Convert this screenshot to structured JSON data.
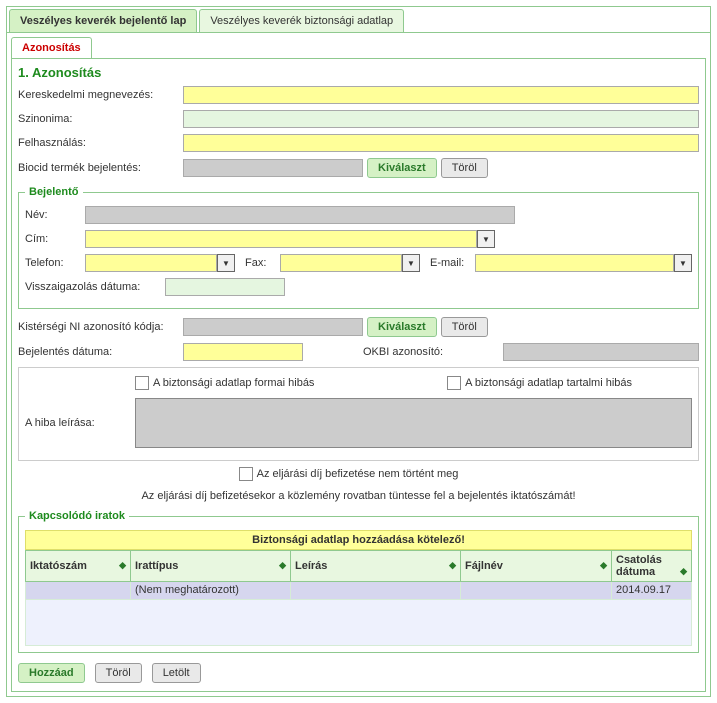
{
  "topTabs": {
    "bejelento": "Veszélyes keverék bejelentő lap",
    "biztonsagi": "Veszélyes keverék biztonsági adatlap"
  },
  "subTab": "Azonosítás",
  "section_title": "1. Azonosítás",
  "labels": {
    "keresk": "Kereskedelmi megnevezés:",
    "szinonima": "Szinonima:",
    "felhaszn": "Felhasználás:",
    "biocid": "Biocid termék bejelentés:",
    "bejelento_legend": "Bejelentő",
    "nev": "Név:",
    "cim": "Cím:",
    "telefon": "Telefon:",
    "fax": "Fax:",
    "email": "E-mail:",
    "vissza": "Visszaigazolás dátuma:",
    "kisters": "Kistérségi NI azonosító kódja:",
    "bejdat": "Bejelentés dátuma:",
    "okbi": "OKBI azonosító:",
    "hibalegend": "A hiba leírása:",
    "formai": "A biztonsági adatlap formai hibás",
    "tartalmi": "A biztonsági adatlap tartalmi hibás",
    "eljdij": "Az eljárási díj befizetése nem történt meg",
    "eljdij_msg": "Az eljárási díj befizetésekor a közlemény rovatban tüntesse fel a bejelentés iktatószámát!",
    "kapcs_legend": "Kapcsolódó iratok",
    "warn": "Biztonsági adatlap hozzáadása kötelező!"
  },
  "buttons": {
    "kivalaszt": "Kiválaszt",
    "torol": "Töröl",
    "hozzaad": "Hozzáad",
    "letolt": "Letölt"
  },
  "grid": {
    "cols": {
      "iktato": "Iktatószám",
      "irattipus": "Irattípus",
      "leiras": "Leírás",
      "fajlnev": "Fájlnév",
      "csatolas": "Csatolás dátuma"
    },
    "rows": [
      {
        "iktato": "",
        "irattipus": "(Nem meghatározott)",
        "leiras": "",
        "fajlnev": "",
        "csatolas": "2014.09.17"
      }
    ]
  },
  "values": {
    "keresk": "",
    "szinonima": "",
    "felhaszn": "",
    "biocid": "",
    "nev": "",
    "cim": "",
    "telefon": "",
    "fax": "",
    "email": "",
    "vissza": "",
    "kisters": "",
    "bejdat": "",
    "okbi": ""
  }
}
